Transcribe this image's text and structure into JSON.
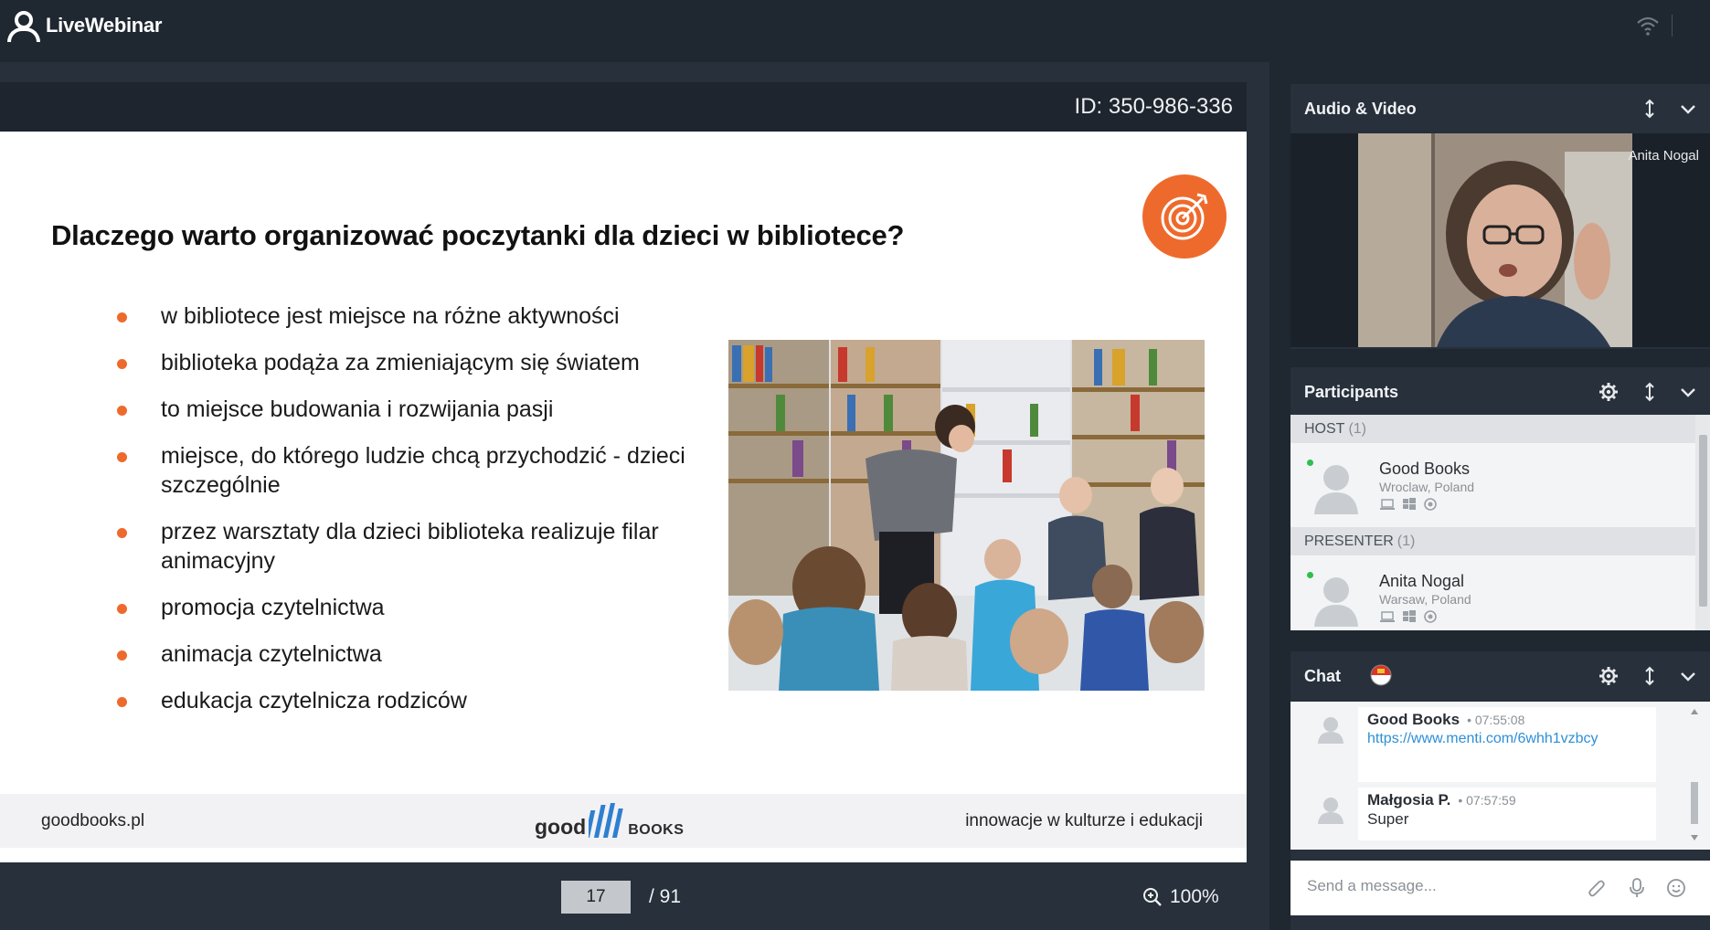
{
  "app": {
    "name": "LiveWebinar"
  },
  "webinar": {
    "id_label": "ID: 350-986-336"
  },
  "slide": {
    "title": "Dlaczego warto organizować poczytanki dla dzieci w bibliotece?",
    "bullets": [
      "w bibliotece jest miejsce na różne aktywności",
      "biblioteka podąża za zmieniającym się światem",
      "to miejsce budowania i rozwijania pasji",
      "miejsce, do którego ludzie chcą przychodzić - dzieci szczególnie",
      "przez warsztaty dla dzieci biblioteka realizuje filar animacyjny",
      "promocja czytelnictwa",
      "animacja czytelnictwa",
      "edukacja czytelnicza rodziców"
    ],
    "footer": {
      "left": "goodbooks.pl",
      "logo_left": "good",
      "logo_right": "books",
      "right": "innowacje w kulturze i edukacji"
    },
    "accent_color": "#ee6a2c"
  },
  "navigation": {
    "current_page": "17",
    "total_pages": "/ 91",
    "zoom": "100%"
  },
  "audio_video": {
    "title": "Audio & Video",
    "speaker_name": "Anita Nogal"
  },
  "participants": {
    "title": "Participants",
    "groups": [
      {
        "label": "HOST",
        "count": "(1)",
        "members": [
          {
            "name": "Good Books",
            "location": "Wroclaw, Poland"
          }
        ]
      },
      {
        "label": "PRESENTER",
        "count": "(1)",
        "members": [
          {
            "name": "Anita Nogal",
            "location": "Warsaw, Poland"
          }
        ]
      }
    ]
  },
  "chat": {
    "title": "Chat",
    "messages": [
      {
        "author": "Good Books",
        "time": "• 07:55:08",
        "link": "https://www.menti.com/6whh1vzbcy"
      },
      {
        "author": "Małgosia P.",
        "time": "• 07:57:59",
        "text": "Super"
      }
    ],
    "input_placeholder": "Send a message..."
  },
  "icons": {
    "logo": "user-headset-logo-icon",
    "wifi": "wifi-icon",
    "target": "target-arrow-icon",
    "zoom": "zoom-in-icon",
    "panel_settings": "gear-icon",
    "panel_reorder": "vertical-arrows-icon",
    "panel_collapse": "chevron-down-icon",
    "translate": "translate-flag-icon",
    "attach": "paperclip-icon",
    "mic": "microphone-icon",
    "emoji": "smiley-icon"
  }
}
